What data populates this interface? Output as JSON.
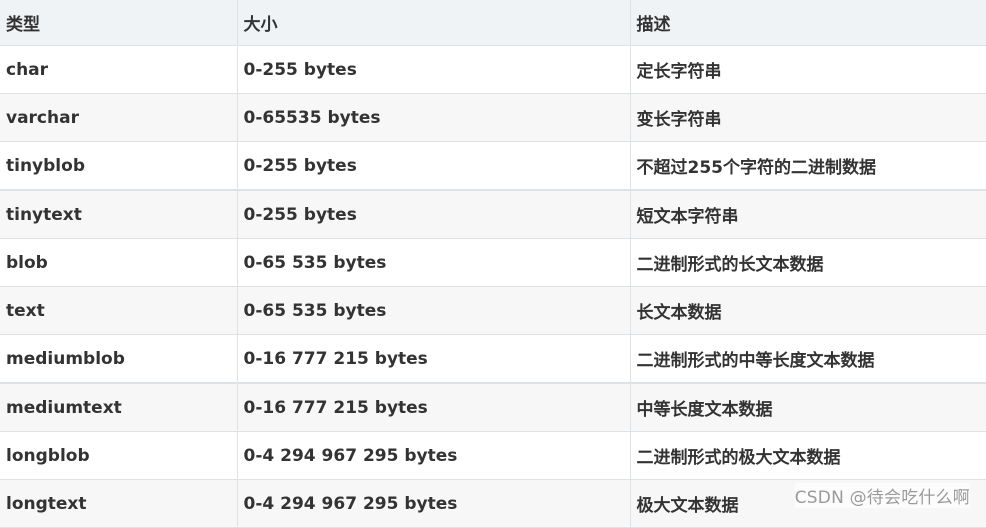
{
  "table": {
    "headers": [
      "类型",
      "大小",
      "描述"
    ],
    "rows": [
      {
        "type": "char",
        "size": "0-255 bytes",
        "desc": "定长字符串"
      },
      {
        "type": "varchar",
        "size": "0-65535 bytes",
        "desc": "变长字符串"
      },
      {
        "type": "tinyblob",
        "size": "0-255 bytes",
        "desc": "不超过255个字符的二进制数据"
      },
      {
        "type": "tinytext",
        "size": "0-255 bytes",
        "desc": "短文本字符串"
      },
      {
        "type": "blob",
        "size": "0-65 535 bytes",
        "desc": "二进制形式的长文本数据"
      },
      {
        "type": "text",
        "size": "0-65 535 bytes",
        "desc": "长文本数据"
      },
      {
        "type": "mediumblob",
        "size": "0-16 777 215 bytes",
        "desc": "二进制形式的中等长度文本数据"
      },
      {
        "type": "mediumtext",
        "size": "0-16 777 215 bytes",
        "desc": "中等长度文本数据"
      },
      {
        "type": "longblob",
        "size": "0-4 294 967 295 bytes",
        "desc": "二进制形式的极大文本数据"
      },
      {
        "type": "longtext",
        "size": "0-4 294 967 295 bytes",
        "desc": "极大文本数据"
      }
    ]
  },
  "watermark": "CSDN @待会吃什么啊"
}
